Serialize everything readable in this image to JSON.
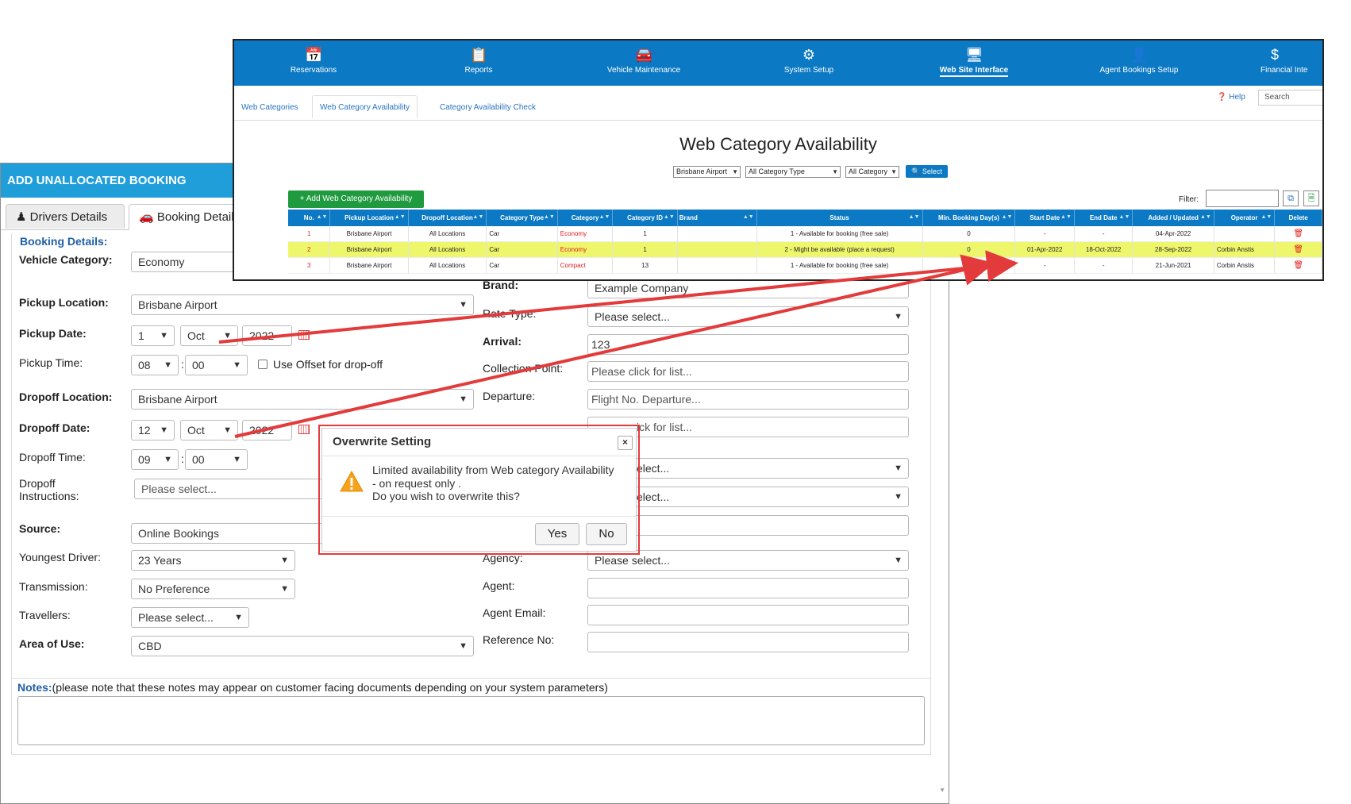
{
  "nav": {
    "items": [
      {
        "label": "Reservations",
        "icon": "calendar-icon"
      },
      {
        "label": "Reports",
        "icon": "clipboard-icon"
      },
      {
        "label": "Vehicle Maintenance",
        "icon": "car-icon"
      },
      {
        "label": "System Setup",
        "icon": "gear-icon"
      },
      {
        "label": "Web Site Interface",
        "icon": "monitor-icon"
      },
      {
        "label": "Agent Bookings Setup",
        "icon": "user-icon"
      },
      {
        "label": "Financial Inte",
        "icon": "dollar-icon"
      }
    ],
    "active": "Web Site Interface"
  },
  "subtabs": [
    "Web Categories",
    "Web Category Availability",
    "Category Availability Check"
  ],
  "header_right": {
    "help": "Help",
    "search_placeholder": "Search"
  },
  "wca": {
    "title": "Web Category Availability",
    "filters": {
      "location": "Brisbane Airport",
      "category_type": "All Category Type",
      "category": "All Category",
      "select_button": "Select"
    },
    "add_button": "+ Add Web Category Availability",
    "filter_label": "Filter:",
    "columns": [
      "No.",
      "Pickup Location",
      "Dropoff Location",
      "Category Type",
      "Category",
      "Category ID",
      "Brand",
      "Status",
      "Min. Booking Day(s)",
      "Start Date",
      "End Date",
      "Added / Updated",
      "Operator",
      "Delete"
    ],
    "rows": [
      {
        "no": "1",
        "pickup": "Brisbane Airport",
        "dropoff": "All Locations",
        "type": "Car",
        "category": "Economy",
        "cat_id": "1",
        "brand": "",
        "status": "1 - Available for booking (free sale)",
        "min_days": "0",
        "start": "-",
        "end": "-",
        "updated": "04-Apr-2022",
        "operator": ""
      },
      {
        "no": "2",
        "pickup": "Brisbane Airport",
        "dropoff": "All Locations",
        "type": "Car",
        "category": "Economy",
        "cat_id": "1",
        "brand": "",
        "status": "2 - Might be available (place a request)",
        "min_days": "0",
        "start": "01-Apr-2022",
        "end": "18-Oct-2022",
        "updated": "28-Sep-2022",
        "operator": "Corbin Anstis"
      },
      {
        "no": "3",
        "pickup": "Brisbane Airport",
        "dropoff": "All Locations",
        "type": "Car",
        "category": "Compact",
        "cat_id": "13",
        "brand": "",
        "status": "1 - Available for booking (free sale)",
        "min_days": "0",
        "start": "-",
        "end": "-",
        "updated": "21-Jun-2021",
        "operator": "Corbin Anstis"
      }
    ]
  },
  "booking": {
    "title": "ADD UNALLOCATED BOOKING",
    "tabs": [
      "Drivers Details",
      "Booking Details"
    ],
    "section_title": "Booking Details:",
    "labels": {
      "vehicle_category": "Vehicle Category:",
      "pickup_location": "Pickup Location:",
      "pickup_date": "Pickup Date:",
      "pickup_time": "Pickup Time:",
      "dropoff_location": "Dropoff Location:",
      "dropoff_date": "Dropoff Date:",
      "dropoff_time": "Dropoff Time:",
      "dropoff_instructions_1": "Dropoff",
      "dropoff_instructions_2": "Instructions:",
      "source": "Source:",
      "youngest_driver": "Youngest Driver:",
      "transmission": "Transmission:",
      "travellers": "Travellers:",
      "area_of_use": "Area of Use:",
      "brand": "Brand:",
      "rate_type": "Rate Type:",
      "arrival": "Arrival:",
      "collection_point": "Collection Point:",
      "departure": "Departure:",
      "agency": "Agency:",
      "agent": "Agent:",
      "agent_email": "Agent Email:",
      "reference_no": "Reference No:",
      "use_offset": "Use Offset for drop-off"
    },
    "values": {
      "vehicle_category": "Economy",
      "pickup_location": "Brisbane Airport",
      "pickup_day": "1",
      "pickup_month": "Oct",
      "pickup_year": "2022",
      "pickup_hour": "08",
      "pickup_min": "00",
      "dropoff_location": "Brisbane Airport",
      "dropoff_day": "12",
      "dropoff_month": "Oct",
      "dropoff_year": "2022",
      "dropoff_hour": "09",
      "dropoff_min": "00",
      "dropoff_instructions": "Please select...",
      "source": "Online Bookings",
      "youngest_driver": "23 Years",
      "transmission": "No Preference",
      "travellers": "Please select...",
      "area_of_use": "CBD",
      "brand": "Example Company",
      "rate_type": "Please select...",
      "arrival": "123",
      "collection_point": "Please click for list...",
      "departure": "Flight No. Departure...",
      "return_point": "ick for list...",
      "select_1": "elect...",
      "select_2": "elect...",
      "agency": "Please select..."
    },
    "notes_label": "Notes:",
    "notes_hint": "(please note that these notes may appear on customer facing documents depending on your system parameters)"
  },
  "dialog": {
    "title": "Overwrite Setting",
    "line1": "Limited availability from Web category Availability",
    "line2": "- on request only .",
    "line3": "Do you wish to overwrite this?",
    "yes": "Yes",
    "no": "No",
    "close": "×"
  },
  "colors": {
    "nav_blue": "#0b79c4",
    "title_blue": "#1f9ed9",
    "highlight": "#eef76c",
    "arrow_red": "#e33b3b",
    "add_green": "#1f9a3f"
  }
}
